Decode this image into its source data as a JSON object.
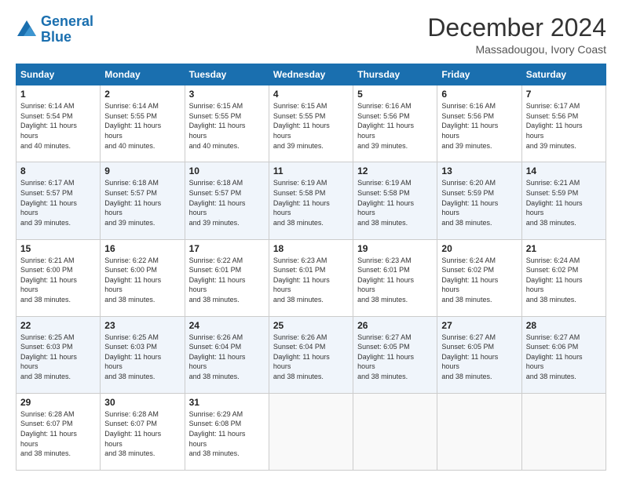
{
  "logo": {
    "line1": "General",
    "line2": "Blue"
  },
  "title": "December 2024",
  "subtitle": "Massadougou, Ivory Coast",
  "days_of_week": [
    "Sunday",
    "Monday",
    "Tuesday",
    "Wednesday",
    "Thursday",
    "Friday",
    "Saturday"
  ],
  "weeks": [
    [
      {
        "day": "1",
        "sunrise": "6:14 AM",
        "sunset": "5:54 PM",
        "daylight": "11 hours and 40 minutes."
      },
      {
        "day": "2",
        "sunrise": "6:14 AM",
        "sunset": "5:55 PM",
        "daylight": "11 hours and 40 minutes."
      },
      {
        "day": "3",
        "sunrise": "6:15 AM",
        "sunset": "5:55 PM",
        "daylight": "11 hours and 40 minutes."
      },
      {
        "day": "4",
        "sunrise": "6:15 AM",
        "sunset": "5:55 PM",
        "daylight": "11 hours and 39 minutes."
      },
      {
        "day": "5",
        "sunrise": "6:16 AM",
        "sunset": "5:56 PM",
        "daylight": "11 hours and 39 minutes."
      },
      {
        "day": "6",
        "sunrise": "6:16 AM",
        "sunset": "5:56 PM",
        "daylight": "11 hours and 39 minutes."
      },
      {
        "day": "7",
        "sunrise": "6:17 AM",
        "sunset": "5:56 PM",
        "daylight": "11 hours and 39 minutes."
      }
    ],
    [
      {
        "day": "8",
        "sunrise": "6:17 AM",
        "sunset": "5:57 PM",
        "daylight": "11 hours and 39 minutes."
      },
      {
        "day": "9",
        "sunrise": "6:18 AM",
        "sunset": "5:57 PM",
        "daylight": "11 hours and 39 minutes."
      },
      {
        "day": "10",
        "sunrise": "6:18 AM",
        "sunset": "5:57 PM",
        "daylight": "11 hours and 39 minutes."
      },
      {
        "day": "11",
        "sunrise": "6:19 AM",
        "sunset": "5:58 PM",
        "daylight": "11 hours and 38 minutes."
      },
      {
        "day": "12",
        "sunrise": "6:19 AM",
        "sunset": "5:58 PM",
        "daylight": "11 hours and 38 minutes."
      },
      {
        "day": "13",
        "sunrise": "6:20 AM",
        "sunset": "5:59 PM",
        "daylight": "11 hours and 38 minutes."
      },
      {
        "day": "14",
        "sunrise": "6:21 AM",
        "sunset": "5:59 PM",
        "daylight": "11 hours and 38 minutes."
      }
    ],
    [
      {
        "day": "15",
        "sunrise": "6:21 AM",
        "sunset": "6:00 PM",
        "daylight": "11 hours and 38 minutes."
      },
      {
        "day": "16",
        "sunrise": "6:22 AM",
        "sunset": "6:00 PM",
        "daylight": "11 hours and 38 minutes."
      },
      {
        "day": "17",
        "sunrise": "6:22 AM",
        "sunset": "6:01 PM",
        "daylight": "11 hours and 38 minutes."
      },
      {
        "day": "18",
        "sunrise": "6:23 AM",
        "sunset": "6:01 PM",
        "daylight": "11 hours and 38 minutes."
      },
      {
        "day": "19",
        "sunrise": "6:23 AM",
        "sunset": "6:01 PM",
        "daylight": "11 hours and 38 minutes."
      },
      {
        "day": "20",
        "sunrise": "6:24 AM",
        "sunset": "6:02 PM",
        "daylight": "11 hours and 38 minutes."
      },
      {
        "day": "21",
        "sunrise": "6:24 AM",
        "sunset": "6:02 PM",
        "daylight": "11 hours and 38 minutes."
      }
    ],
    [
      {
        "day": "22",
        "sunrise": "6:25 AM",
        "sunset": "6:03 PM",
        "daylight": "11 hours and 38 minutes."
      },
      {
        "day": "23",
        "sunrise": "6:25 AM",
        "sunset": "6:03 PM",
        "daylight": "11 hours and 38 minutes."
      },
      {
        "day": "24",
        "sunrise": "6:26 AM",
        "sunset": "6:04 PM",
        "daylight": "11 hours and 38 minutes."
      },
      {
        "day": "25",
        "sunrise": "6:26 AM",
        "sunset": "6:04 PM",
        "daylight": "11 hours and 38 minutes."
      },
      {
        "day": "26",
        "sunrise": "6:27 AM",
        "sunset": "6:05 PM",
        "daylight": "11 hours and 38 minutes."
      },
      {
        "day": "27",
        "sunrise": "6:27 AM",
        "sunset": "6:05 PM",
        "daylight": "11 hours and 38 minutes."
      },
      {
        "day": "28",
        "sunrise": "6:27 AM",
        "sunset": "6:06 PM",
        "daylight": "11 hours and 38 minutes."
      }
    ],
    [
      {
        "day": "29",
        "sunrise": "6:28 AM",
        "sunset": "6:07 PM",
        "daylight": "11 hours and 38 minutes."
      },
      {
        "day": "30",
        "sunrise": "6:28 AM",
        "sunset": "6:07 PM",
        "daylight": "11 hours and 38 minutes."
      },
      {
        "day": "31",
        "sunrise": "6:29 AM",
        "sunset": "6:08 PM",
        "daylight": "11 hours and 38 minutes."
      },
      null,
      null,
      null,
      null
    ]
  ]
}
